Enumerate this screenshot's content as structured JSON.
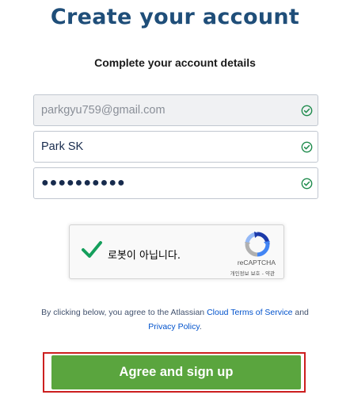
{
  "header": {
    "title": "Create your account",
    "subtitle": "Complete your account details"
  },
  "form": {
    "email": {
      "value": "parkgyu759@gmail.com",
      "valid": true
    },
    "name": {
      "value": "Park SK",
      "valid": true
    },
    "password": {
      "value": "●●●●●●●●●●",
      "valid": true
    }
  },
  "recaptcha": {
    "label": "로봇이 아닙니다.",
    "brand": "reCAPTCHA",
    "privacy": "개인정보 보호",
    "separator": " - ",
    "terms": "약관",
    "checked": true
  },
  "terms_notice": {
    "prefix": "By clicking below, you agree to the Atlassian ",
    "cloud_terms_link": "Cloud Terms of Service",
    "middle": " and",
    "privacy_link": "Privacy Policy",
    "suffix": "."
  },
  "actions": {
    "submit_label": "Agree and sign up"
  },
  "colors": {
    "title": "#1f4e79",
    "valid_check": "#1e8b4c",
    "button": "#5aa53e",
    "link": "#0052cc",
    "highlight": "#cc1f1f"
  }
}
